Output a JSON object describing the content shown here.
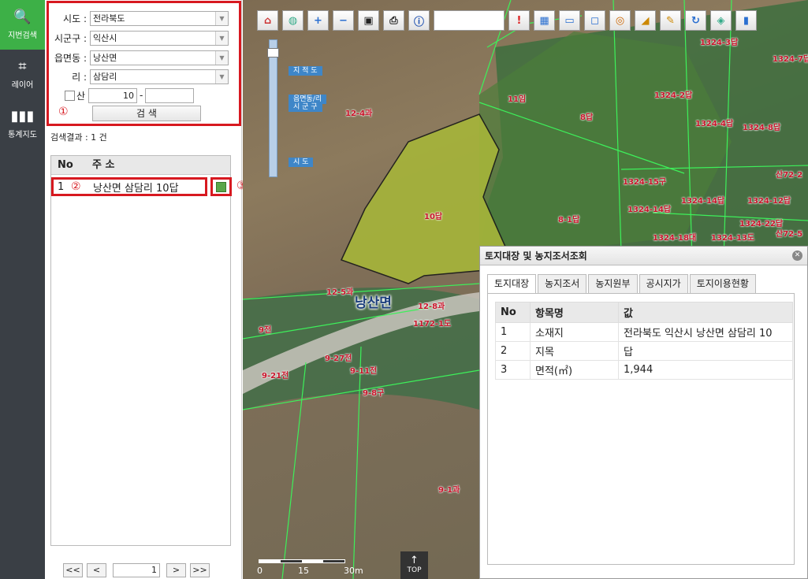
{
  "nav": [
    {
      "label": "지번검색",
      "icon": "search-icon",
      "active": true
    },
    {
      "label": "레이어",
      "icon": "layer-icon",
      "active": false
    },
    {
      "label": "통계지도",
      "icon": "bar-chart-icon",
      "active": false
    }
  ],
  "search": {
    "sido_label": "시도 :",
    "sido_value": "전라북도",
    "sigungu_label": "시군구 :",
    "sigungu_value": "익산시",
    "eup_label": "읍면동 :",
    "eup_value": "낭산면",
    "ri_label": "리 :",
    "ri_value": "삼담리",
    "san_label": "산",
    "bonbun_value": "10",
    "dash": "-",
    "bubun_value": "",
    "button_label": "검 색",
    "marker1": "①"
  },
  "results": {
    "count_text": "검색결과 : 1 건",
    "header_no": "No",
    "header_addr": "주 소",
    "rows": [
      {
        "no": "1",
        "marker": "②",
        "addr": "낭산면 삼담리 10답"
      }
    ],
    "marker3": "③"
  },
  "pager": {
    "first": "<<",
    "prev": "<",
    "page": "1",
    "next": ">",
    "last": ">>"
  },
  "map": {
    "zoom_labels": [
      "지 적 도",
      "읍면동/리",
      "시 군 구",
      "시 도"
    ],
    "parcel_labels": [
      "11임",
      "8답",
      "12-4과",
      "10답",
      "8-1답",
      "12-5과",
      "12-8과",
      "1172-1도",
      "9전",
      "9-27전",
      "9-11전",
      "9-21전",
      "9-8구",
      "9-1과",
      "1324-3답",
      "1324-7답",
      "1324-2답",
      "1324-4답",
      "1324-8답",
      "1324-15구",
      "1324-14답",
      "1324-12답",
      "1324-14답",
      "1324-18대",
      "1324-13도",
      "1324-22답",
      "산72-2",
      "산72-5"
    ],
    "place_name": "낭산면",
    "scale_labels": [
      "0",
      "15",
      "30m"
    ],
    "top_label": "TOP"
  },
  "popup": {
    "title": "토지대장 및 농지조서조회",
    "tabs": [
      "토지대장",
      "농지조서",
      "농지원부",
      "공시지가",
      "토지이용현황"
    ],
    "table_headers": [
      "No",
      "항목명",
      "값"
    ],
    "rows": [
      {
        "no": "1",
        "name": "소재지",
        "value": "전라북도 익산시 낭산면 삼담리 10"
      },
      {
        "no": "2",
        "name": "지목",
        "value": "답"
      },
      {
        "no": "3",
        "name": "면적(㎡)",
        "value": "1,944"
      }
    ]
  }
}
